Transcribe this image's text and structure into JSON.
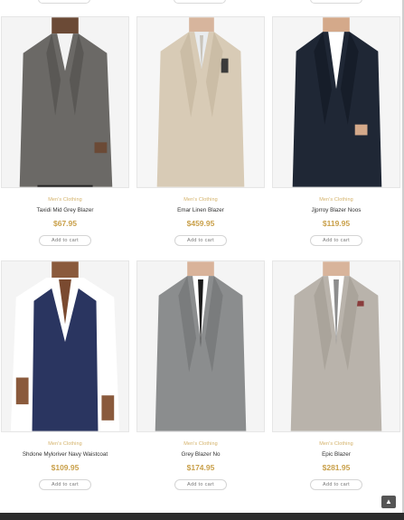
{
  "products": [
    {
      "category": "Men's Clothing",
      "name": "Taxidi Mid Grey Blazer",
      "price": "$67.95",
      "cart_label": "Add to cart",
      "colors": {
        "suit": "#6b6966",
        "shirt": "#f3f3f3",
        "bg": "#f4f4f4",
        "skin": "#6b4a36"
      }
    },
    {
      "category": "Men's Clothing",
      "name": "Emar Linen Blazer",
      "price": "$459.95",
      "cart_label": "Add to cart",
      "colors": {
        "suit": "#d8cbb6",
        "shirt": "#e9ecef",
        "bg": "#f6f6f6",
        "skin": "#d7b59d"
      }
    },
    {
      "category": "Men's Clothing",
      "name": "Jjprroy Blazer Noos",
      "price": "$119.95",
      "cart_label": "Add to cart",
      "colors": {
        "suit": "#1f2735",
        "shirt": "#ffffff",
        "bg": "#f5f5f5",
        "skin": "#d4a98a"
      }
    },
    {
      "category": "Men's Clothing",
      "name": "Shdone Myloriver Navy Waistcoat",
      "price": "$109.95",
      "cart_label": "Add to cart",
      "colors": {
        "suit": "#2a3560",
        "shirt": "#ffffff",
        "bg": "#f4f4f4",
        "skin": "#8a5a3c"
      }
    },
    {
      "category": "Men's Clothing",
      "name": "Grey Blazer No",
      "price": "$174.95",
      "cart_label": "Add to cart",
      "colors": {
        "suit": "#8b8d8e",
        "shirt": "#ffffff",
        "bg": "#f4f4f4",
        "skin": "#d9b39a"
      }
    },
    {
      "category": "Men's Clothing",
      "name": "Epic Blazer",
      "price": "$281.95",
      "cart_label": "Add to cart",
      "colors": {
        "suit": "#b9b3ab",
        "shirt": "#ffffff",
        "bg": "#f5f5f5",
        "skin": "#d8b49b"
      }
    }
  ],
  "back_to_top_icon": "arrow-up-icon"
}
